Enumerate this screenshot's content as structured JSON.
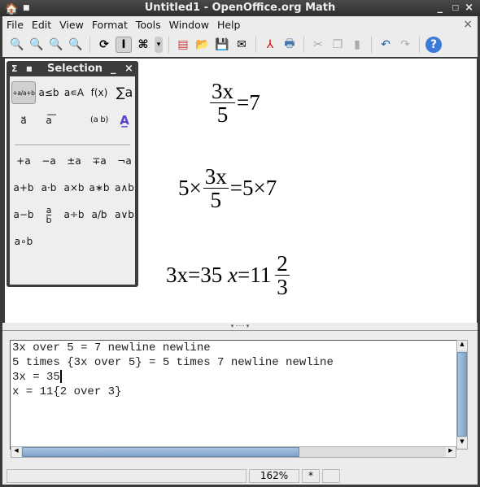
{
  "window": {
    "title": "Untitled1 - OpenOffice.org Math"
  },
  "menu": [
    "File",
    "Edit",
    "View",
    "Format",
    "Tools",
    "Window",
    "Help"
  ],
  "toolbar": {
    "icons": [
      "zoom-in-icon",
      "zoom-out-icon",
      "show-all-icon",
      "zoom-icon",
      "update-icon",
      "formula-cursor-icon",
      "symbols-icon",
      "new-icon",
      "open-icon",
      "save-icon",
      "email-icon",
      "pdf-icon",
      "print-icon",
      "cut-icon",
      "copy-icon",
      "paste-icon",
      "undo-icon",
      "redo-icon",
      "help-icon"
    ]
  },
  "selection": {
    "title": "Selection",
    "categories": [
      "+a/a+b",
      "a≤b",
      "a∊A",
      "f(x)",
      "∑a",
      "a⃗",
      "a💬",
      "(a b)",
      "A✎"
    ],
    "operators": [
      "+a",
      "−a",
      "±a",
      "∓a",
      "¬a",
      "a+b",
      "a·b",
      "a×b",
      "a∗b",
      "a∧b",
      "a−b",
      "a/b frac",
      "a÷b",
      "a/b",
      "a∨b",
      "a∘b"
    ]
  },
  "formulas": {
    "f1": {
      "num": "3x",
      "den": "5",
      "rest": "=7"
    },
    "f2": {
      "pre": "5×",
      "num": "3x",
      "den": "5",
      "rest": "=5×7"
    },
    "f3": {
      "pre": "3x=35",
      "x": "x",
      "eq": "=11",
      "num": "2",
      "den": "3"
    }
  },
  "commands": [
    "3x over 5 = 7 newline newline",
    "5 times {3x over 5} = 5 times 7 newline newline",
    "3x = 35",
    "x = 11{2 over 3}"
  ],
  "status": {
    "zoom": "162%",
    "modified": "*"
  }
}
